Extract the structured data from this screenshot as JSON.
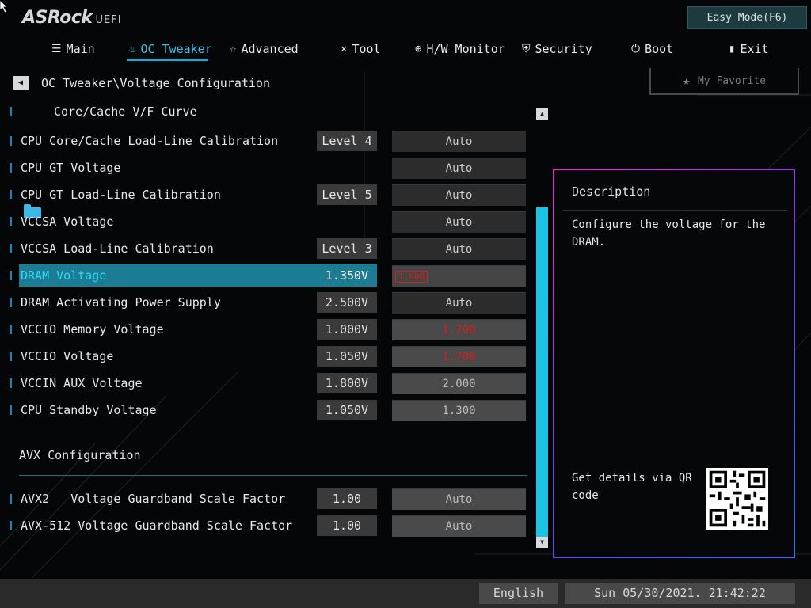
{
  "brand": {
    "name": "ASRock",
    "suffix": "UEFI"
  },
  "easy_mode_label": "Easy Mode(F6)",
  "nav": [
    {
      "label": "Main",
      "icon": "list-icon"
    },
    {
      "label": "OC Tweaker",
      "icon": "flame-icon",
      "active": true
    },
    {
      "label": "Advanced",
      "icon": "star-outline-icon"
    },
    {
      "label": "Tool",
      "icon": "tools-icon"
    },
    {
      "label": "H/W Monitor",
      "icon": "globe-icon"
    },
    {
      "label": "Security",
      "icon": "shield-icon"
    },
    {
      "label": "Boot",
      "icon": "power-icon"
    },
    {
      "label": "Exit",
      "icon": "exit-door-icon"
    }
  ],
  "breadcrumb": "OC Tweaker\\Voltage Configuration",
  "favorite_label": "My Favorite",
  "folder_item": "Core/Cache V/F Curve",
  "settings": [
    {
      "label": "CPU Core/Cache Load-Line Calibration",
      "current": "Level 4",
      "value": "Auto"
    },
    {
      "label": "CPU GT Voltage",
      "current": "",
      "value": "Auto"
    },
    {
      "label": "CPU GT Load-Line Calibration",
      "current": "Level 5",
      "value": "Auto"
    },
    {
      "label": "VCCSA Voltage",
      "current": "",
      "value": "Auto"
    },
    {
      "label": "VCCSA Load-Line Calibration",
      "current": "Level 3",
      "value": "Auto"
    },
    {
      "label": "DRAM Voltage",
      "current": "1.350V",
      "value": "1.600"
    },
    {
      "label": "DRAM Activating Power Supply",
      "current": "2.500V",
      "value": "Auto"
    },
    {
      "label": "VCCIO_Memory Voltage",
      "current": "1.000V",
      "value": "1.700"
    },
    {
      "label": "VCCIO Voltage",
      "current": "1.050V",
      "value": "1.700"
    },
    {
      "label": "VCCIN AUX Voltage",
      "current": "1.800V",
      "value": "2.000"
    },
    {
      "label": "CPU Standby Voltage",
      "current": "1.050V",
      "value": "1.300"
    }
  ],
  "avx_section_title": "AVX Configuration",
  "avx_settings": [
    {
      "label": "AVX2   Voltage Guardband Scale Factor",
      "current": "1.00",
      "value": "Auto"
    },
    {
      "label": "AVX-512 Voltage Guardband Scale Factor",
      "current": "1.00",
      "value": "Auto"
    }
  ],
  "description": {
    "title": "Description",
    "text": "Configure the voltage for the DRAM.",
    "qr_text": "Get details via QR code"
  },
  "footer": {
    "language": "English",
    "datetime": "Sun 05/30/2021. 21:42:22"
  },
  "colors": {
    "accent": "#1ba9d3",
    "highlight_row": "#1b7c94",
    "warning_red": "#d81e1e",
    "scrollbar": "#1ac2e6"
  }
}
